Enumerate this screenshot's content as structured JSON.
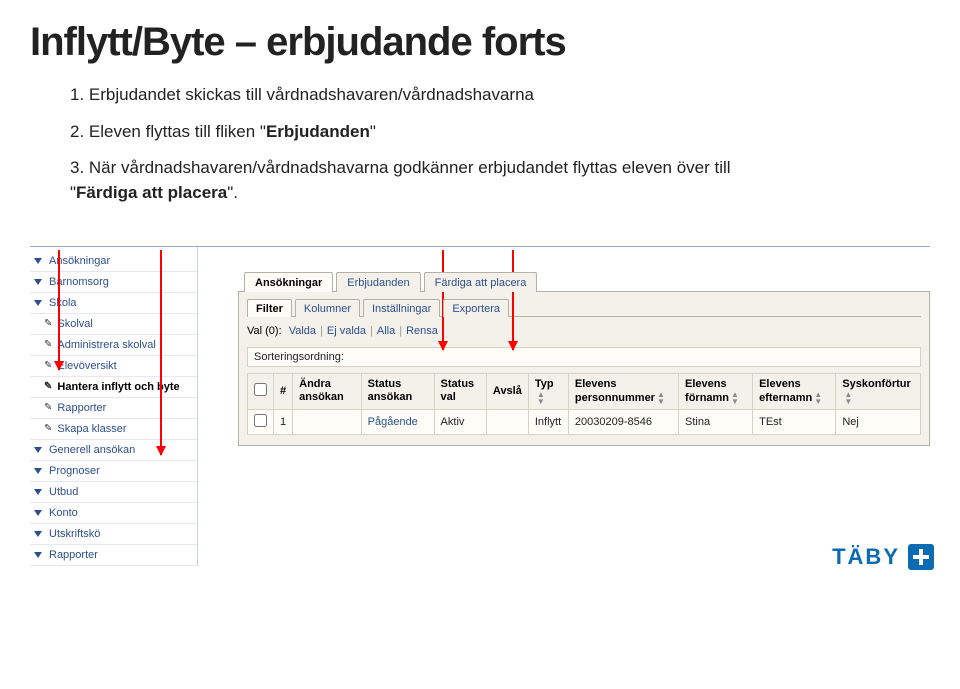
{
  "title": "Inflytt/Byte – erbjudande forts",
  "intro": {
    "p1": "1. Erbjudandet skickas till vårdnadshavaren/vårdnadshavarna",
    "p2a": "2. Eleven flyttas till fliken \"",
    "p2b": "Erbjudanden",
    "p2c": "\"",
    "p3a": "3. När vårdnadshavaren/vårdnadshavarna godkänner erbjudandet flyttas eleven över till \"",
    "p3b": "Färdiga att placera",
    "p3c": "\"."
  },
  "sidebar": [
    {
      "label": "Ansökningar",
      "type": "section"
    },
    {
      "label": "Barnomsorg",
      "type": "section"
    },
    {
      "label": "Skola",
      "type": "section"
    },
    {
      "label": "Skolval",
      "type": "sub"
    },
    {
      "label": "Administrera skolval",
      "type": "sub"
    },
    {
      "label": "Elevöversikt",
      "type": "sub"
    },
    {
      "label": "Hantera inflytt och byte",
      "type": "sub",
      "active": true
    },
    {
      "label": "Rapporter",
      "type": "sub"
    },
    {
      "label": "Skapa klasser",
      "type": "sub"
    },
    {
      "label": "Generell ansökan",
      "type": "section"
    },
    {
      "label": "Prognoser",
      "type": "section"
    },
    {
      "label": "Utbud",
      "type": "section"
    },
    {
      "label": "Konto",
      "type": "section"
    },
    {
      "label": "Utskriftskö",
      "type": "section"
    },
    {
      "label": "Rapporter",
      "type": "section"
    }
  ],
  "tabs": [
    {
      "label": "Ansökningar",
      "active": true
    },
    {
      "label": "Erbjudanden",
      "active": false
    },
    {
      "label": "Färdiga att placera",
      "active": false
    }
  ],
  "filter_tabs": [
    {
      "label": "Filter",
      "active": true
    },
    {
      "label": "Kolumner",
      "active": false
    },
    {
      "label": "Inställningar",
      "active": false
    },
    {
      "label": "Exportera",
      "active": false
    }
  ],
  "valrow": {
    "prefix": "Val (0):",
    "links": [
      "Valda",
      "Ej valda",
      "Alla",
      "Rensa"
    ]
  },
  "sort_label": "Sorteringsordning:",
  "columns": [
    "",
    "#",
    "Ändra ansökan",
    "Status ansökan",
    "Status val",
    "Avslå",
    "Typ",
    "Elevens personnummer",
    "Elevens förnamn",
    "Elevens efternamn",
    "Syskonförtur"
  ],
  "rows": [
    {
      "num": "1",
      "andra": "",
      "status_ansokan": "Pågående",
      "status_val": "Aktiv",
      "avsla": "",
      "typ": "Inflytt",
      "pnr": "20030209-8546",
      "fornamn": "Stina",
      "efternamn": "TEst",
      "syskon": "Nej"
    }
  ],
  "brand": "TÄBY"
}
